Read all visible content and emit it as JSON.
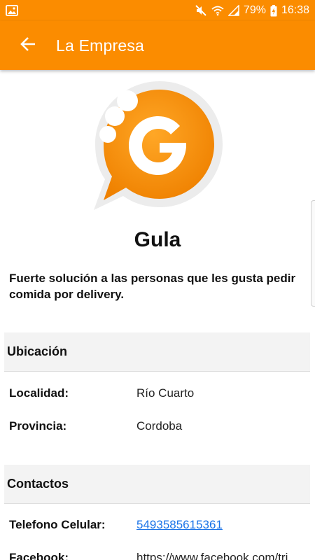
{
  "status_bar": {
    "battery": "79%",
    "time": "16:38",
    "icons": [
      "image-icon",
      "mute-icon",
      "wifi-icon",
      "signal-icon",
      "battery-charging-icon"
    ]
  },
  "app_bar": {
    "title": "La Empresa",
    "back_icon": "arrow-back-icon"
  },
  "company": {
    "logo_letter": "G",
    "name": "Gula",
    "description": "Fuerte solución a las personas que les gusta pedir comida por delivery."
  },
  "ubicacion": {
    "header": "Ubicación",
    "rows": [
      {
        "label": "Localidad:",
        "value": "Río Cuarto"
      },
      {
        "label": "Provincia:",
        "value": "Cordoba"
      }
    ]
  },
  "contactos": {
    "header": "Contactos",
    "rows": [
      {
        "label": "Telefono Celular:",
        "value": "5493585615361"
      },
      {
        "label": "Facebook:",
        "value": "https://www.facebook.com/tri"
      }
    ]
  },
  "colors": {
    "primary": "#fb8c00",
    "section_bg": "#f3f3f3",
    "link": "#1a73e8"
  }
}
